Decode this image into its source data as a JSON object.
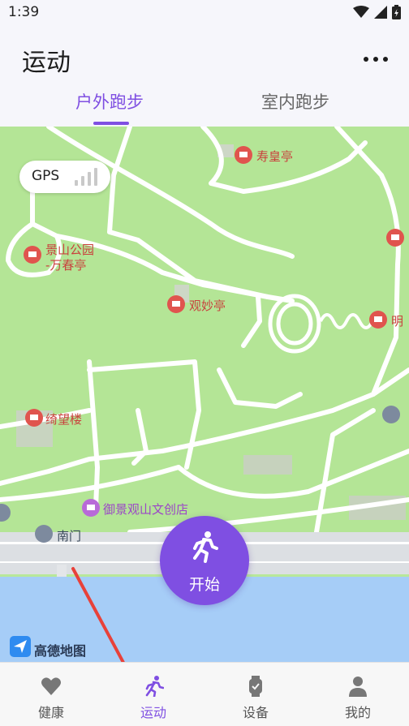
{
  "status": {
    "time": "1:39"
  },
  "header": {
    "title": "运动",
    "tabs": [
      {
        "label": "户外跑步",
        "active": true
      },
      {
        "label": "室内跑步",
        "active": false
      }
    ]
  },
  "map": {
    "gps_label": "GPS",
    "pois": [
      "寿皇亭",
      "景山公园",
      "-万春亭",
      "观妙亭",
      "明",
      "绮望楼",
      "御景观山文创店",
      "南门"
    ],
    "provider": "高德地图"
  },
  "start_button": {
    "label": "开始"
  },
  "nav": {
    "items": [
      {
        "label": "健康",
        "icon": "heart-icon",
        "active": false
      },
      {
        "label": "运动",
        "icon": "running-icon",
        "active": true
      },
      {
        "label": "设备",
        "icon": "watch-icon",
        "active": false
      },
      {
        "label": "我的",
        "icon": "person-icon",
        "active": false
      }
    ]
  },
  "colors": {
    "accent": "#7f4fe2",
    "map_green": "#b8e89a",
    "water": "#a6cdf7",
    "poi_red": "#e0544e"
  }
}
